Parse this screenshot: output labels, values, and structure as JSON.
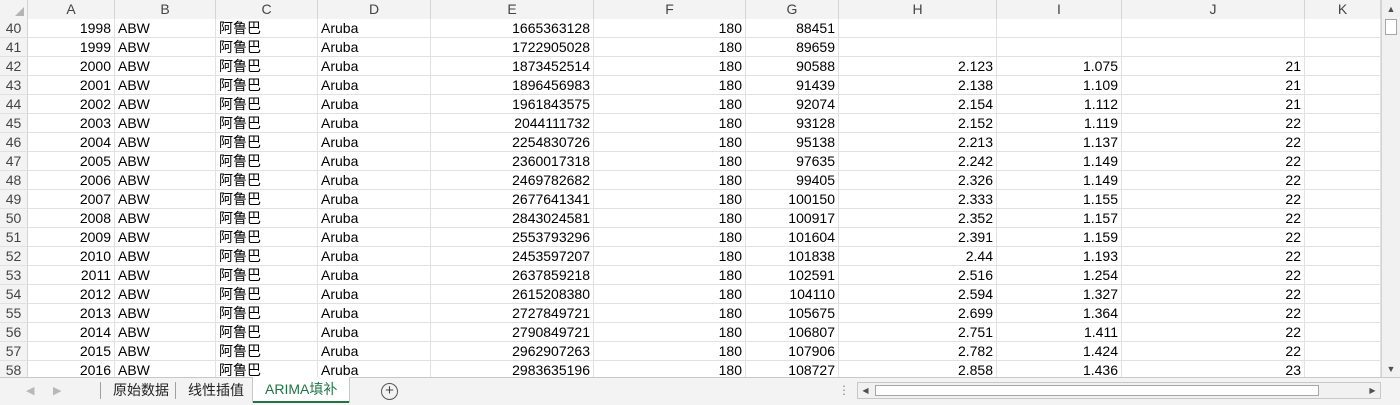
{
  "columns": [
    "A",
    "B",
    "C",
    "D",
    "E",
    "F",
    "G",
    "H",
    "I",
    "J",
    "K"
  ],
  "rows": [
    {
      "row": "40",
      "a": "1998",
      "b": "ABW",
      "c": "阿鲁巴",
      "d": "Aruba",
      "e": "1665363128",
      "f": "180",
      "g": "88451",
      "h": "",
      "i": "",
      "j": ""
    },
    {
      "row": "41",
      "a": "1999",
      "b": "ABW",
      "c": "阿鲁巴",
      "d": "Aruba",
      "e": "1722905028",
      "f": "180",
      "g": "89659",
      "h": "",
      "i": "",
      "j": ""
    },
    {
      "row": "42",
      "a": "2000",
      "b": "ABW",
      "c": "阿鲁巴",
      "d": "Aruba",
      "e": "1873452514",
      "f": "180",
      "g": "90588",
      "h": "2.123",
      "i": "1.075",
      "j": "21"
    },
    {
      "row": "43",
      "a": "2001",
      "b": "ABW",
      "c": "阿鲁巴",
      "d": "Aruba",
      "e": "1896456983",
      "f": "180",
      "g": "91439",
      "h": "2.138",
      "i": "1.109",
      "j": "21"
    },
    {
      "row": "44",
      "a": "2002",
      "b": "ABW",
      "c": "阿鲁巴",
      "d": "Aruba",
      "e": "1961843575",
      "f": "180",
      "g": "92074",
      "h": "2.154",
      "i": "1.112",
      "j": "21"
    },
    {
      "row": "45",
      "a": "2003",
      "b": "ABW",
      "c": "阿鲁巴",
      "d": "Aruba",
      "e": "2044111732",
      "f": "180",
      "g": "93128",
      "h": "2.152",
      "i": "1.119",
      "j": "22"
    },
    {
      "row": "46",
      "a": "2004",
      "b": "ABW",
      "c": "阿鲁巴",
      "d": "Aruba",
      "e": "2254830726",
      "f": "180",
      "g": "95138",
      "h": "2.213",
      "i": "1.137",
      "j": "22"
    },
    {
      "row": "47",
      "a": "2005",
      "b": "ABW",
      "c": "阿鲁巴",
      "d": "Aruba",
      "e": "2360017318",
      "f": "180",
      "g": "97635",
      "h": "2.242",
      "i": "1.149",
      "j": "22"
    },
    {
      "row": "48",
      "a": "2006",
      "b": "ABW",
      "c": "阿鲁巴",
      "d": "Aruba",
      "e": "2469782682",
      "f": "180",
      "g": "99405",
      "h": "2.326",
      "i": "1.149",
      "j": "22"
    },
    {
      "row": "49",
      "a": "2007",
      "b": "ABW",
      "c": "阿鲁巴",
      "d": "Aruba",
      "e": "2677641341",
      "f": "180",
      "g": "100150",
      "h": "2.333",
      "i": "1.155",
      "j": "22"
    },
    {
      "row": "50",
      "a": "2008",
      "b": "ABW",
      "c": "阿鲁巴",
      "d": "Aruba",
      "e": "2843024581",
      "f": "180",
      "g": "100917",
      "h": "2.352",
      "i": "1.157",
      "j": "22"
    },
    {
      "row": "51",
      "a": "2009",
      "b": "ABW",
      "c": "阿鲁巴",
      "d": "Aruba",
      "e": "2553793296",
      "f": "180",
      "g": "101604",
      "h": "2.391",
      "i": "1.159",
      "j": "22"
    },
    {
      "row": "52",
      "a": "2010",
      "b": "ABW",
      "c": "阿鲁巴",
      "d": "Aruba",
      "e": "2453597207",
      "f": "180",
      "g": "101838",
      "h": "2.44",
      "i": "1.193",
      "j": "22"
    },
    {
      "row": "53",
      "a": "2011",
      "b": "ABW",
      "c": "阿鲁巴",
      "d": "Aruba",
      "e": "2637859218",
      "f": "180",
      "g": "102591",
      "h": "2.516",
      "i": "1.254",
      "j": "22"
    },
    {
      "row": "54",
      "a": "2012",
      "b": "ABW",
      "c": "阿鲁巴",
      "d": "Aruba",
      "e": "2615208380",
      "f": "180",
      "g": "104110",
      "h": "2.594",
      "i": "1.327",
      "j": "22"
    },
    {
      "row": "55",
      "a": "2013",
      "b": "ABW",
      "c": "阿鲁巴",
      "d": "Aruba",
      "e": "2727849721",
      "f": "180",
      "g": "105675",
      "h": "2.699",
      "i": "1.364",
      "j": "22"
    },
    {
      "row": "56",
      "a": "2014",
      "b": "ABW",
      "c": "阿鲁巴",
      "d": "Aruba",
      "e": "2790849721",
      "f": "180",
      "g": "106807",
      "h": "2.751",
      "i": "1.411",
      "j": "22"
    },
    {
      "row": "57",
      "a": "2015",
      "b": "ABW",
      "c": "阿鲁巴",
      "d": "Aruba",
      "e": "2962907263",
      "f": "180",
      "g": "107906",
      "h": "2.782",
      "i": "1.424",
      "j": "22"
    },
    {
      "row": "58",
      "a": "2016",
      "b": "ABW",
      "c": "阿鲁巴",
      "d": "Aruba",
      "e": "2983635196",
      "f": "180",
      "g": "108727",
      "h": "2.858",
      "i": "1.436",
      "j": "23"
    }
  ],
  "sheets": [
    {
      "label": "原始数据",
      "active": false
    },
    {
      "label": "线性插值",
      "active": false
    },
    {
      "label": "ARIMA填补",
      "active": true
    }
  ],
  "icons": {
    "tab_prev": "chevron-left-icon",
    "tab_next": "chevron-right-icon",
    "add_sheet": "plus-circle-icon",
    "scroll_up": "triangle-up-icon",
    "scroll_down": "triangle-down-icon",
    "scroll_left": "triangle-left-icon",
    "scroll_right": "triangle-right-icon"
  },
  "colors": {
    "active_tab": "#217346",
    "header_bg": "#f3f3f3",
    "gridline": "#e1e1e1"
  }
}
